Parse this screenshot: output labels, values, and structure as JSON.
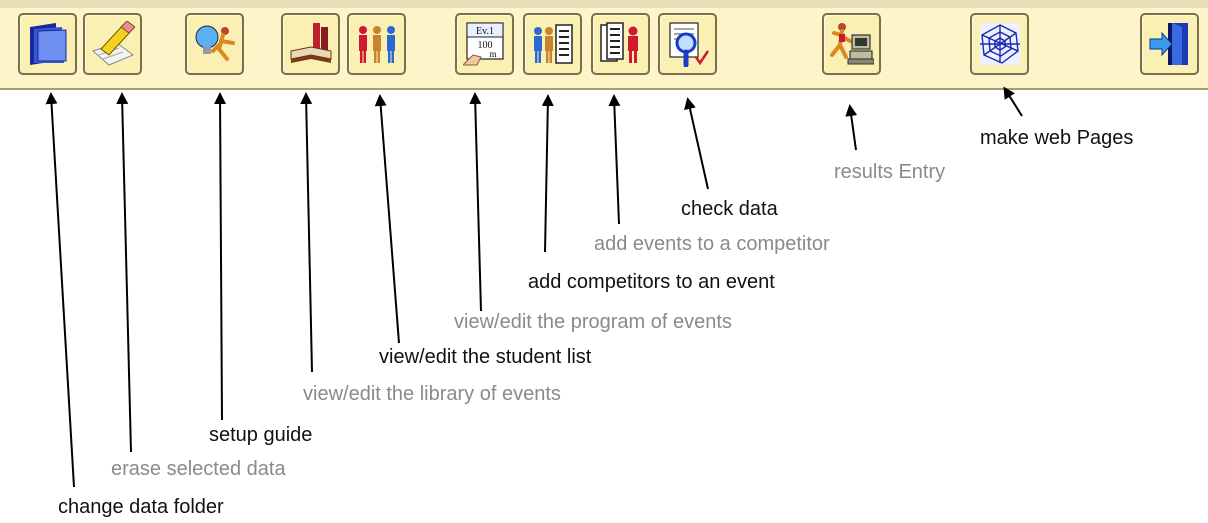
{
  "toolbar": {
    "buttons": [
      {
        "name": "change-data-folder-button",
        "icon": "folder-icon"
      },
      {
        "name": "erase-selected-data-button",
        "icon": "eraser-icon"
      },
      {
        "name": "setup-guide-button",
        "icon": "lightbulb-runner-icon"
      },
      {
        "name": "library-of-events-button",
        "icon": "books-icon"
      },
      {
        "name": "student-list-button",
        "icon": "people-icon"
      },
      {
        "name": "program-of-events-button",
        "icon": "event-card-icon",
        "card_text": [
          "Ev.1",
          "100",
          "m"
        ]
      },
      {
        "name": "add-competitors-to-event-button",
        "icon": "person-list-icon"
      },
      {
        "name": "add-events-to-competitor-button",
        "icon": "list-person-icon"
      },
      {
        "name": "check-data-button",
        "icon": "magnifier-check-icon"
      },
      {
        "name": "results-entry-button",
        "icon": "runner-computer-icon"
      },
      {
        "name": "make-web-pages-button",
        "icon": "web-icon"
      },
      {
        "name": "exit-button",
        "icon": "exit-door-icon"
      }
    ]
  },
  "annotations": {
    "make_web_pages": "make web Pages",
    "results_entry": "results Entry",
    "check_data": "check data",
    "add_events_to_competitor": "add events to a competitor",
    "add_competitors_to_event": "add competitors to an event",
    "program_of_events": "view/edit the program of events",
    "student_list": "view/edit the student list",
    "library_of_events": "view/edit the library of events",
    "setup_guide": "setup guide",
    "erase_selected_data": "erase selected data",
    "change_data_folder": "change data folder"
  },
  "colors": {
    "toolbar_bg": "#fdf4ca",
    "button_bg": "#fbf0b4",
    "label_black": "#111111",
    "label_gray": "#8a8a8a"
  }
}
